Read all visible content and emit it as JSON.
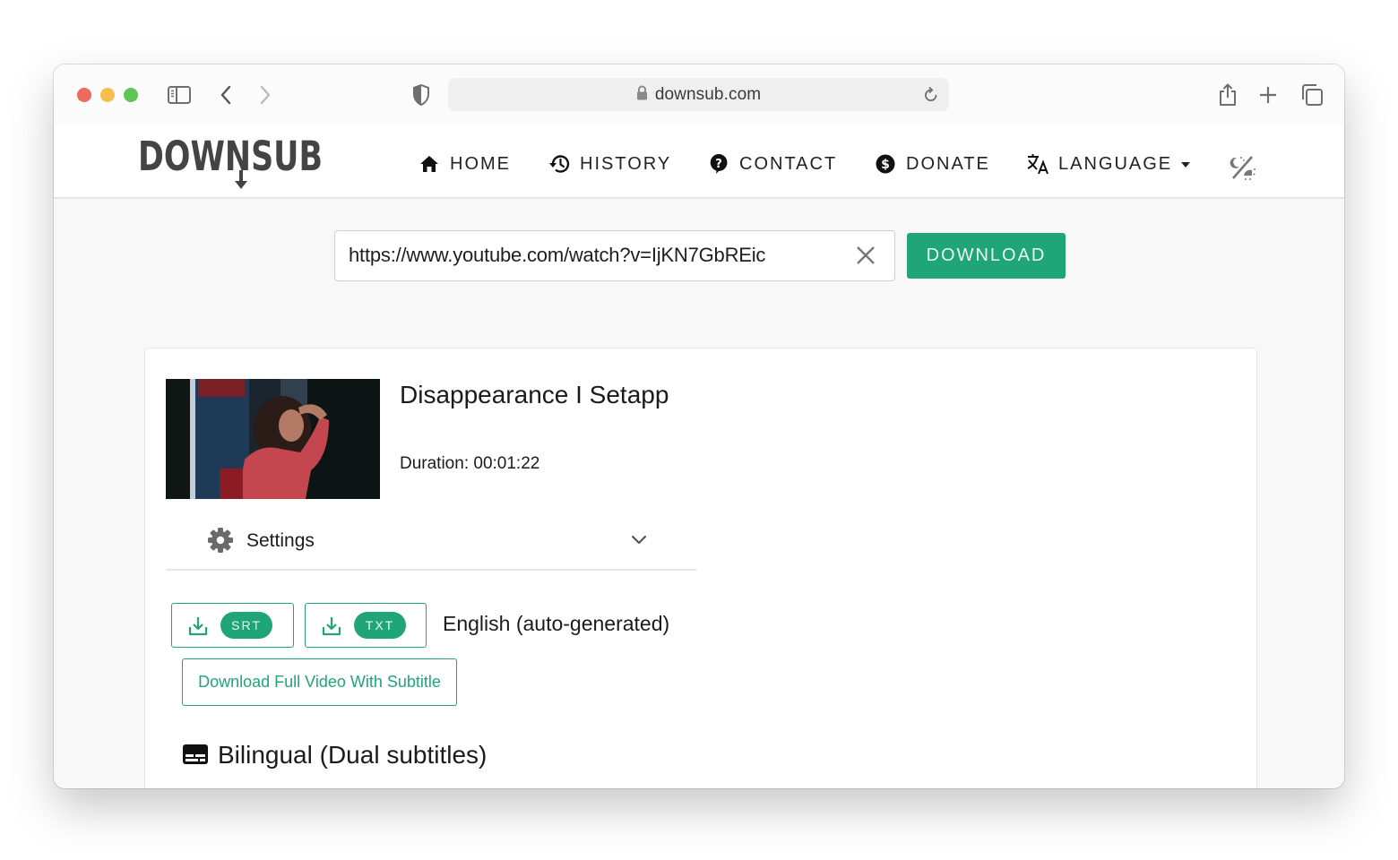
{
  "browser": {
    "address": "downsub.com",
    "icons": {
      "window_controls": [
        "close",
        "minimize",
        "maximize"
      ],
      "sidebar": "sidebar-icon",
      "back": "chevron-left-icon",
      "forward": "chevron-right-icon",
      "privacy": "shield-icon",
      "lock": "lock-icon",
      "reload": "reload-icon",
      "share": "share-icon",
      "new_tab": "plus-icon",
      "tab_overview": "tabs-icon"
    }
  },
  "site": {
    "logo_text": "DOWNSUB",
    "nav": [
      {
        "label": "HOME",
        "icon": "home-icon"
      },
      {
        "label": "HISTORY",
        "icon": "history-icon"
      },
      {
        "label": "CONTACT",
        "icon": "question-icon"
      },
      {
        "label": "DONATE",
        "icon": "dollar-icon"
      },
      {
        "label": "LANGUAGE",
        "icon": "translate-icon",
        "has_dropdown": true
      }
    ],
    "theme_toggle_icon": "dark-light-toggle-icon"
  },
  "search": {
    "url_value": "https://www.youtube.com/watch?v=IjKN7GbREic",
    "clear_icon": "close-icon",
    "download_label": "DOWNLOAD"
  },
  "result": {
    "title": "Disappearance I Setapp",
    "duration_label": "Duration: 00:01:22",
    "settings_label": "Settings",
    "subtitles": [
      {
        "language": "English (auto-generated)",
        "formats": [
          "SRT",
          "TXT"
        ]
      }
    ],
    "full_video_button": "Download Full Video With Subtitle",
    "bilingual_heading": "Bilingual (Dual subtitles)"
  },
  "colors": {
    "accent": "#20a579",
    "text": "#1b1b1b",
    "page_bg": "#f8f8f8"
  }
}
